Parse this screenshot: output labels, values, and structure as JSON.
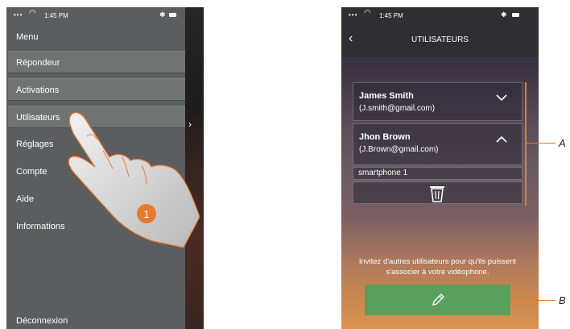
{
  "left_screen": {
    "status": {
      "time": "1:45 PM"
    },
    "menu": {
      "title": "Menu",
      "items": [
        {
          "label": "Répondeur"
        },
        {
          "label": "Activations"
        },
        {
          "label": "Utilisateurs"
        },
        {
          "label": "Réglages"
        },
        {
          "label": "Compte"
        },
        {
          "label": "Aide"
        },
        {
          "label": "Informations"
        }
      ],
      "logout_label": "Déconnexion"
    },
    "step_badge": "1"
  },
  "right_screen": {
    "status": {
      "time": "1:45 PM"
    },
    "header": {
      "title": "UTILISATEURS"
    },
    "users": [
      {
        "name": "James Smith",
        "email": "(J.smith@gmail.com)",
        "expanded": false
      },
      {
        "name": "Jhon Brown",
        "email": "(J.Brown@gmail.com)",
        "expanded": true,
        "devices": [
          "smartphone 1"
        ]
      }
    ],
    "invite_text": "Invitez d'autres utilisateurs pour qu'ils puissent s'associer à votre vidéophone."
  },
  "callouts": {
    "a": "A",
    "b": "B"
  },
  "colors": {
    "accent_orange": "#e67a2e",
    "invite_green": "#58a05c"
  }
}
